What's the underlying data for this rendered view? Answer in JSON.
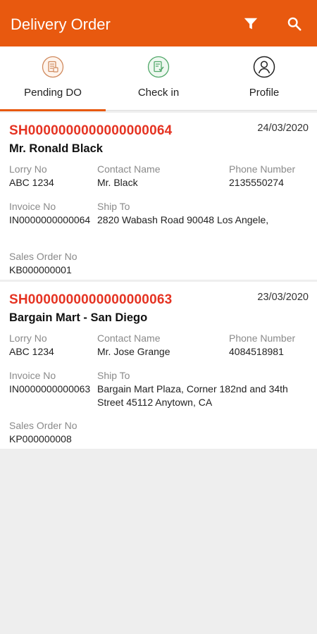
{
  "appbar": {
    "title": "Delivery Order",
    "filter_icon": "filter-icon",
    "search_icon": "search-icon",
    "background": "#e8590f"
  },
  "tabs": [
    {
      "label": "Pending DO",
      "icon": "document-list-icon",
      "active": true
    },
    {
      "label": "Check in",
      "icon": "checkin-document-icon",
      "active": false
    },
    {
      "label": "Profile",
      "icon": "user-profile-icon",
      "active": false
    }
  ],
  "labels": {
    "lorry": "Lorry No",
    "contact": "Contact Name",
    "phone": "Phone Number",
    "invoice": "Invoice No",
    "ship": "Ship To",
    "sales": "Sales Order No"
  },
  "orders": [
    {
      "order_no": "SH0000000000000000064",
      "date": "24/03/2020",
      "customer": "Mr. Ronald Black",
      "lorry": "ABC 1234",
      "contact": "Mr. Black",
      "phone": "2135550274",
      "invoice": "IN0000000000064",
      "ship_to": "2820 Wabash Road 90048 Los Angele,",
      "sales_order": "KB000000001"
    },
    {
      "order_no": "SH0000000000000000063",
      "date": "23/03/2020",
      "customer": "Bargain Mart - San Diego",
      "lorry": "ABC 1234",
      "contact": "Mr. Jose Grange",
      "phone": "4084518981",
      "invoice": "IN0000000000063",
      "ship_to": "Bargain Mart Plaza, Corner 182nd and 34th Street 45112 Anytown, CA",
      "sales_order": "KP000000008"
    }
  ]
}
